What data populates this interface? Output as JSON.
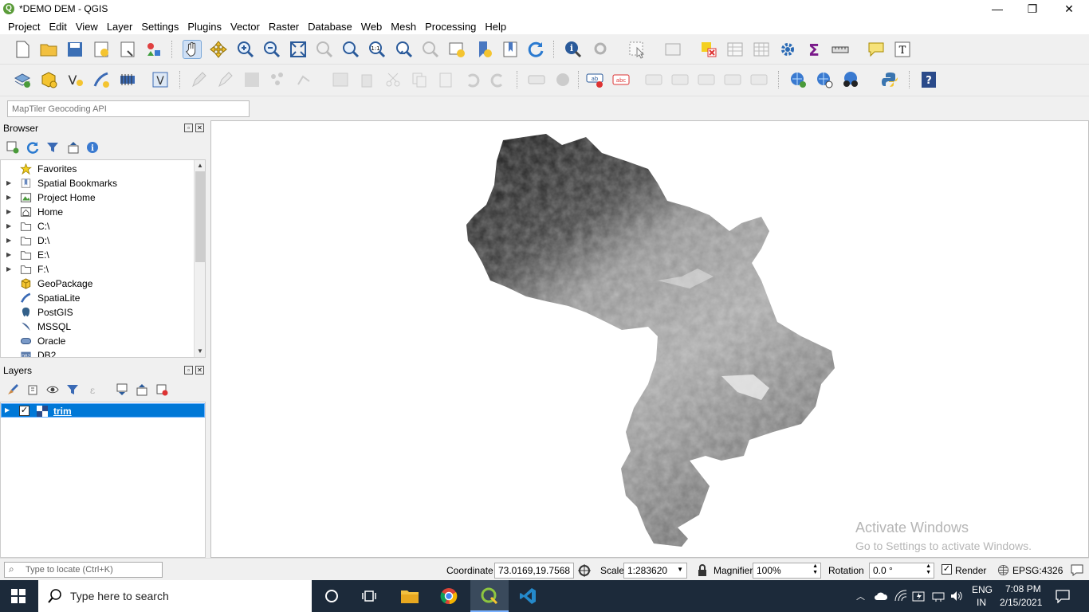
{
  "window": {
    "title": "*DEMO DEM - QGIS",
    "icon": "qgis-logo-icon",
    "minimize": "—",
    "restore": "❐",
    "close": "✕"
  },
  "menu": [
    {
      "label": "Project"
    },
    {
      "label": "Edit"
    },
    {
      "label": "View"
    },
    {
      "label": "Layer"
    },
    {
      "label": "Settings"
    },
    {
      "label": "Plugins"
    },
    {
      "label": "Vector"
    },
    {
      "label": "Raster"
    },
    {
      "label": "Database"
    },
    {
      "label": "Web"
    },
    {
      "label": "Mesh"
    },
    {
      "label": "Processing"
    },
    {
      "label": "Help"
    }
  ],
  "geocoder": {
    "placeholder": "MapTiler Geocoding API"
  },
  "browser": {
    "title": "Browser",
    "items": [
      {
        "label": "Favorites",
        "icon": "star-icon",
        "expandable": false
      },
      {
        "label": "Spatial Bookmarks",
        "icon": "bookmark-icon",
        "expandable": true
      },
      {
        "label": "Project Home",
        "icon": "project-home-icon",
        "expandable": true
      },
      {
        "label": "Home",
        "icon": "home-folder-icon",
        "expandable": true
      },
      {
        "label": "C:\\",
        "icon": "folder-icon",
        "expandable": true
      },
      {
        "label": "D:\\",
        "icon": "folder-icon",
        "expandable": true
      },
      {
        "label": "E:\\",
        "icon": "folder-icon",
        "expandable": true
      },
      {
        "label": "F:\\",
        "icon": "folder-icon",
        "expandable": true
      },
      {
        "label": "GeoPackage",
        "icon": "geopackage-icon",
        "expandable": false
      },
      {
        "label": "SpatiaLite",
        "icon": "spatialite-icon",
        "expandable": false
      },
      {
        "label": "PostGIS",
        "icon": "postgis-icon",
        "expandable": false
      },
      {
        "label": "MSSQL",
        "icon": "mssql-icon",
        "expandable": false
      },
      {
        "label": "Oracle",
        "icon": "oracle-icon",
        "expandable": false
      },
      {
        "label": "DB2",
        "icon": "db2-icon",
        "expandable": false
      }
    ]
  },
  "layers": {
    "title": "Layers",
    "items": [
      {
        "label": "trim",
        "checked": true,
        "icon": "raster-layer-icon"
      }
    ]
  },
  "map": {
    "watermark_title": "Activate Windows",
    "watermark_sub": "Go to Settings to activate Windows."
  },
  "status": {
    "locate_placeholder": "Type to locate (Ctrl+K)",
    "coordinate_label": "Coordinate",
    "coordinate_value": "73.0169,19.7568",
    "scale_label": "Scale",
    "scale_value": "1:283620",
    "magnifier_label": "Magnifier",
    "magnifier_value": "100%",
    "rotation_label": "Rotation",
    "rotation_value": "0.0 °",
    "render_label": "Render",
    "render_checked": true,
    "crs": "EPSG:4326"
  },
  "taskbar": {
    "search_placeholder": "Type here to search",
    "lang_top": "ENG",
    "lang_bottom": "IN",
    "time": "7:08 PM",
    "date": "2/15/2021"
  }
}
